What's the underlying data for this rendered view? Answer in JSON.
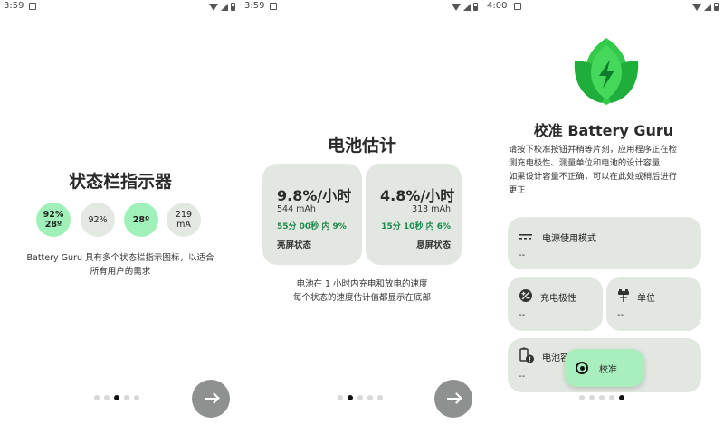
{
  "screens": [
    {
      "time": "3:59",
      "title": "状态栏指示器",
      "indicators": [
        {
          "line1": "92%",
          "line2": "28º"
        },
        {
          "line1": "92%",
          "line2": ""
        },
        {
          "line1": "28º",
          "line2": ""
        },
        {
          "line1": "219",
          "line2": "mA"
        }
      ],
      "desc_line1": "Battery Guru 具有多个状态栏指示图标，以适合",
      "desc_line2": "所有用户的需求",
      "active_page": 3
    },
    {
      "time": "3:59",
      "title": "电池估计",
      "cards": [
        {
          "rate": "9.8%/小时",
          "mah": "544 mAh",
          "duration": "55分 00秒 内 9%",
          "state": "亮屏状态"
        },
        {
          "rate": "4.8%/小时",
          "mah": "313 mAh",
          "duration": "15分 10秒 内 6%",
          "state": "息屏状态"
        }
      ],
      "desc_line1": "电池在 1 小时内充电和放电的速度",
      "desc_line2": "每个状态的速度估计值都显示在底部",
      "active_page": 2
    },
    {
      "time": "4:00",
      "title": "校准 Battery Guru",
      "desc_line1": "请按下校准按钮并稍等片刻，应用程序正在检",
      "desc_line2": "测充电极性、测量单位和电池的设计容量",
      "desc_line3": "如果设计容量不正确，可以在此处或稍后进行",
      "desc_line4": "更正",
      "tiles": {
        "power_mode": {
          "label": "电源使用模式",
          "value": "--"
        },
        "polarity": {
          "label": "充电极性",
          "value": "--"
        },
        "unit": {
          "label": "单位",
          "value": "--"
        },
        "capacity": {
          "label": "电池容",
          "value": "--"
        }
      },
      "calibrate_label": "校准",
      "active_page": 5
    }
  ],
  "colors": {
    "accent_green": "#9ff1b9",
    "card_bg": "#e2e8e1",
    "duration_green": "#1c8a4e",
    "button_gray": "#8f9190"
  },
  "icons": [
    "notification-icon",
    "wifi-icon",
    "signal-icon",
    "battery-icon",
    "arrow-right-icon",
    "battery-guru-logo",
    "power-mode-icon",
    "polarity-icon",
    "unit-icon",
    "battery-capacity-icon",
    "target-icon"
  ]
}
